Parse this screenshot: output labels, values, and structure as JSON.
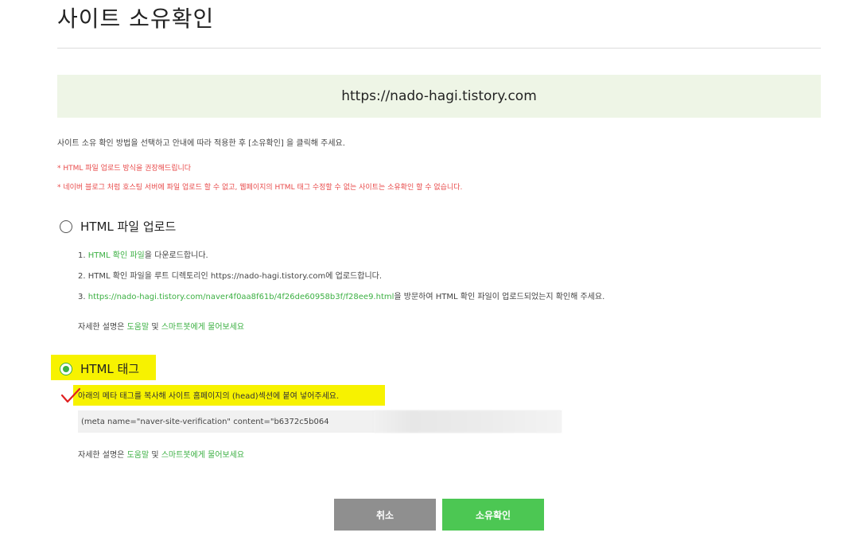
{
  "page": {
    "title": "사이트 소유확인",
    "site_url": "https://nado-hagi.tistory.com",
    "instruction": "사이트 소유 확인 방법을 선택하고 안내에 따라 적용한 후 [소유확인] 을 클릭해 주세요.",
    "notes": [
      "* HTML 파일 업로드 방식을 권장해드립니다",
      "* 네이버 블로그 처럼 호스팅 서버에 파일 업로드 할 수 없고, 웹페이지의 HTML 태그 수정할 수 없는 사이트는 소유확인 할 수 없습니다."
    ]
  },
  "option_file": {
    "label": "HTML 파일 업로드",
    "selected": false,
    "step1_prefix": "1. ",
    "step1_link": "HTML 확인 파일",
    "step1_suffix": "을 다운로드합니다.",
    "step2": "2. HTML 확인 파일을 루트 디렉토리인 https://nado-hagi.tistory.com에 업로드합니다.",
    "step3_prefix": "3. ",
    "step3_link": "https://nado-hagi.tistory.com/naver4f0aa8f61b/4f26de60958b3f/f28ee9.html",
    "step3_suffix": "을 방문하여 HTML 확인 파일이 업로드되었는지 확인해 주세요.",
    "help_prefix": "자세한 설명은 ",
    "help_link1": "도움말",
    "help_mid": " 및 ",
    "help_link2": "스마트봇에게 물어보세요"
  },
  "option_tag": {
    "label": "HTML 태그",
    "selected": true,
    "instruction": "아래의 메타 태그를 복사해 사이트 홈페이지의 (head)섹션에 붙여 넣어주세요.",
    "meta_code": "(meta name=\"naver-site-verification\" content=\"b6372c5b064",
    "help_prefix": "자세한 설명은 ",
    "help_link1": "도움말",
    "help_mid": " 및 ",
    "help_link2": "스마트봇에게 물어보세요"
  },
  "buttons": {
    "cancel": "취소",
    "confirm": "소유확인"
  },
  "colors": {
    "accent_green": "#4cc753",
    "link_green": "#3cb043",
    "warning_red": "#e84a4a",
    "highlight_yellow": "#f7f200",
    "url_box_bg": "#eef5e6"
  }
}
